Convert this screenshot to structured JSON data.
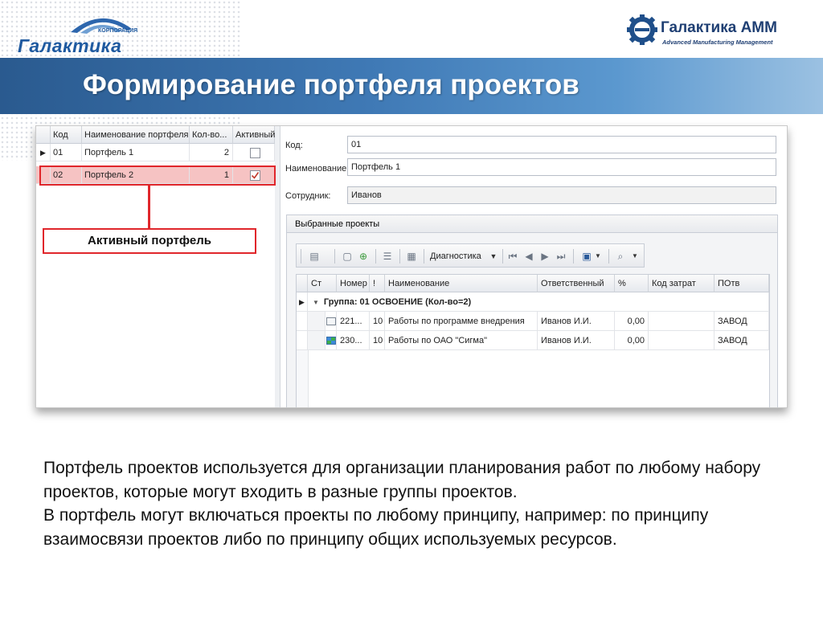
{
  "header": {
    "left_logo": {
      "brand": "Галактика",
      "corp": "КОРПОРАЦИЯ"
    },
    "right_logo": {
      "brand": "Галактика АММ",
      "subtitle": "Advanced Manufacturing Management"
    },
    "title": "Формирование портфеля проектов"
  },
  "portfolio_grid": {
    "columns": [
      "Код",
      "Наименование портфеля",
      "Кол-во...",
      "Активный"
    ],
    "rows": [
      {
        "code": "01",
        "name": "Портфель 1",
        "count": "2",
        "active": false
      },
      {
        "code": "02",
        "name": "Портфель 2",
        "count": "1",
        "active": true
      }
    ]
  },
  "form": {
    "code_label": "Код:",
    "code_value": "01",
    "name_label": "Наименование:",
    "name_value": "Портфель 1",
    "employee_label": "Сотрудник:",
    "employee_value": "Иванов"
  },
  "selected_projects": {
    "title": "Выбранные проекты",
    "toolbar": {
      "diagnostics_label": "Диагностика"
    },
    "columns": [
      "Ст",
      "Номер",
      "!",
      "Наименование",
      "Ответственный",
      "%",
      "Код затрат",
      "ПОтв"
    ],
    "group_label": "Группа: 01 ОСВОЕНИЕ (Кол-во=2)",
    "rows": [
      {
        "number": "221...",
        "priority": "10",
        "name": "Работы по программе внедрения",
        "responsible": "Иванов И.И.",
        "percent": "0,00",
        "cost_code": "",
        "potv": "ЗАВОД"
      },
      {
        "number": "230...",
        "priority": "10",
        "name": "Работы по ОАО \"Сигма\"",
        "responsible": "Иванов И.И.",
        "percent": "0,00",
        "cost_code": "",
        "potv": "ЗАВОД"
      }
    ]
  },
  "annotation": {
    "callout": "Активный портфель"
  },
  "body": {
    "paragraph1": "Портфель проектов используется для организации планирования работ по любому набору проектов, которые могут входить в разные группы проектов.",
    "paragraph2": "В портфель могут включаться проекты по любому принципу, например: по принципу взаимосвязи проектов либо по принципу общих используемых ресурсов."
  },
  "colors": {
    "accent_red": "#e0262b",
    "title_blue": "#2a5a8f",
    "selected_row": "#f6c3c3"
  }
}
